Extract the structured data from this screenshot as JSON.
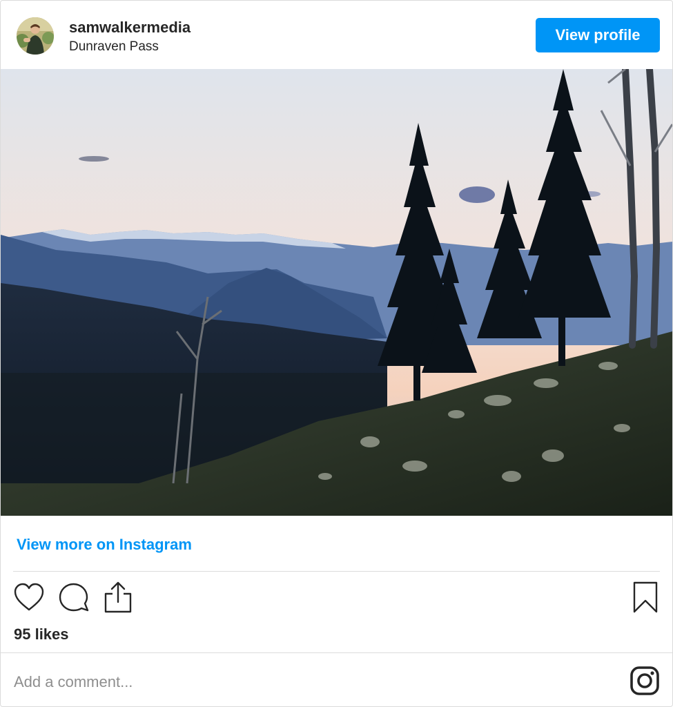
{
  "post": {
    "username": "samwalkermedia",
    "location": "Dunraven Pass",
    "view_profile_label": "View profile",
    "view_more_label": "View more on Instagram",
    "likes_text": "95 likes",
    "comment_placeholder": "Add a comment..."
  },
  "icons": {
    "like": "heart-icon",
    "comment": "comment-icon",
    "share": "share-icon",
    "save": "bookmark-icon",
    "brand": "instagram-icon"
  },
  "colors": {
    "accent": "#0095f6",
    "text": "#262626",
    "muted": "#8e8e8e",
    "border": "#dbdbdb"
  }
}
